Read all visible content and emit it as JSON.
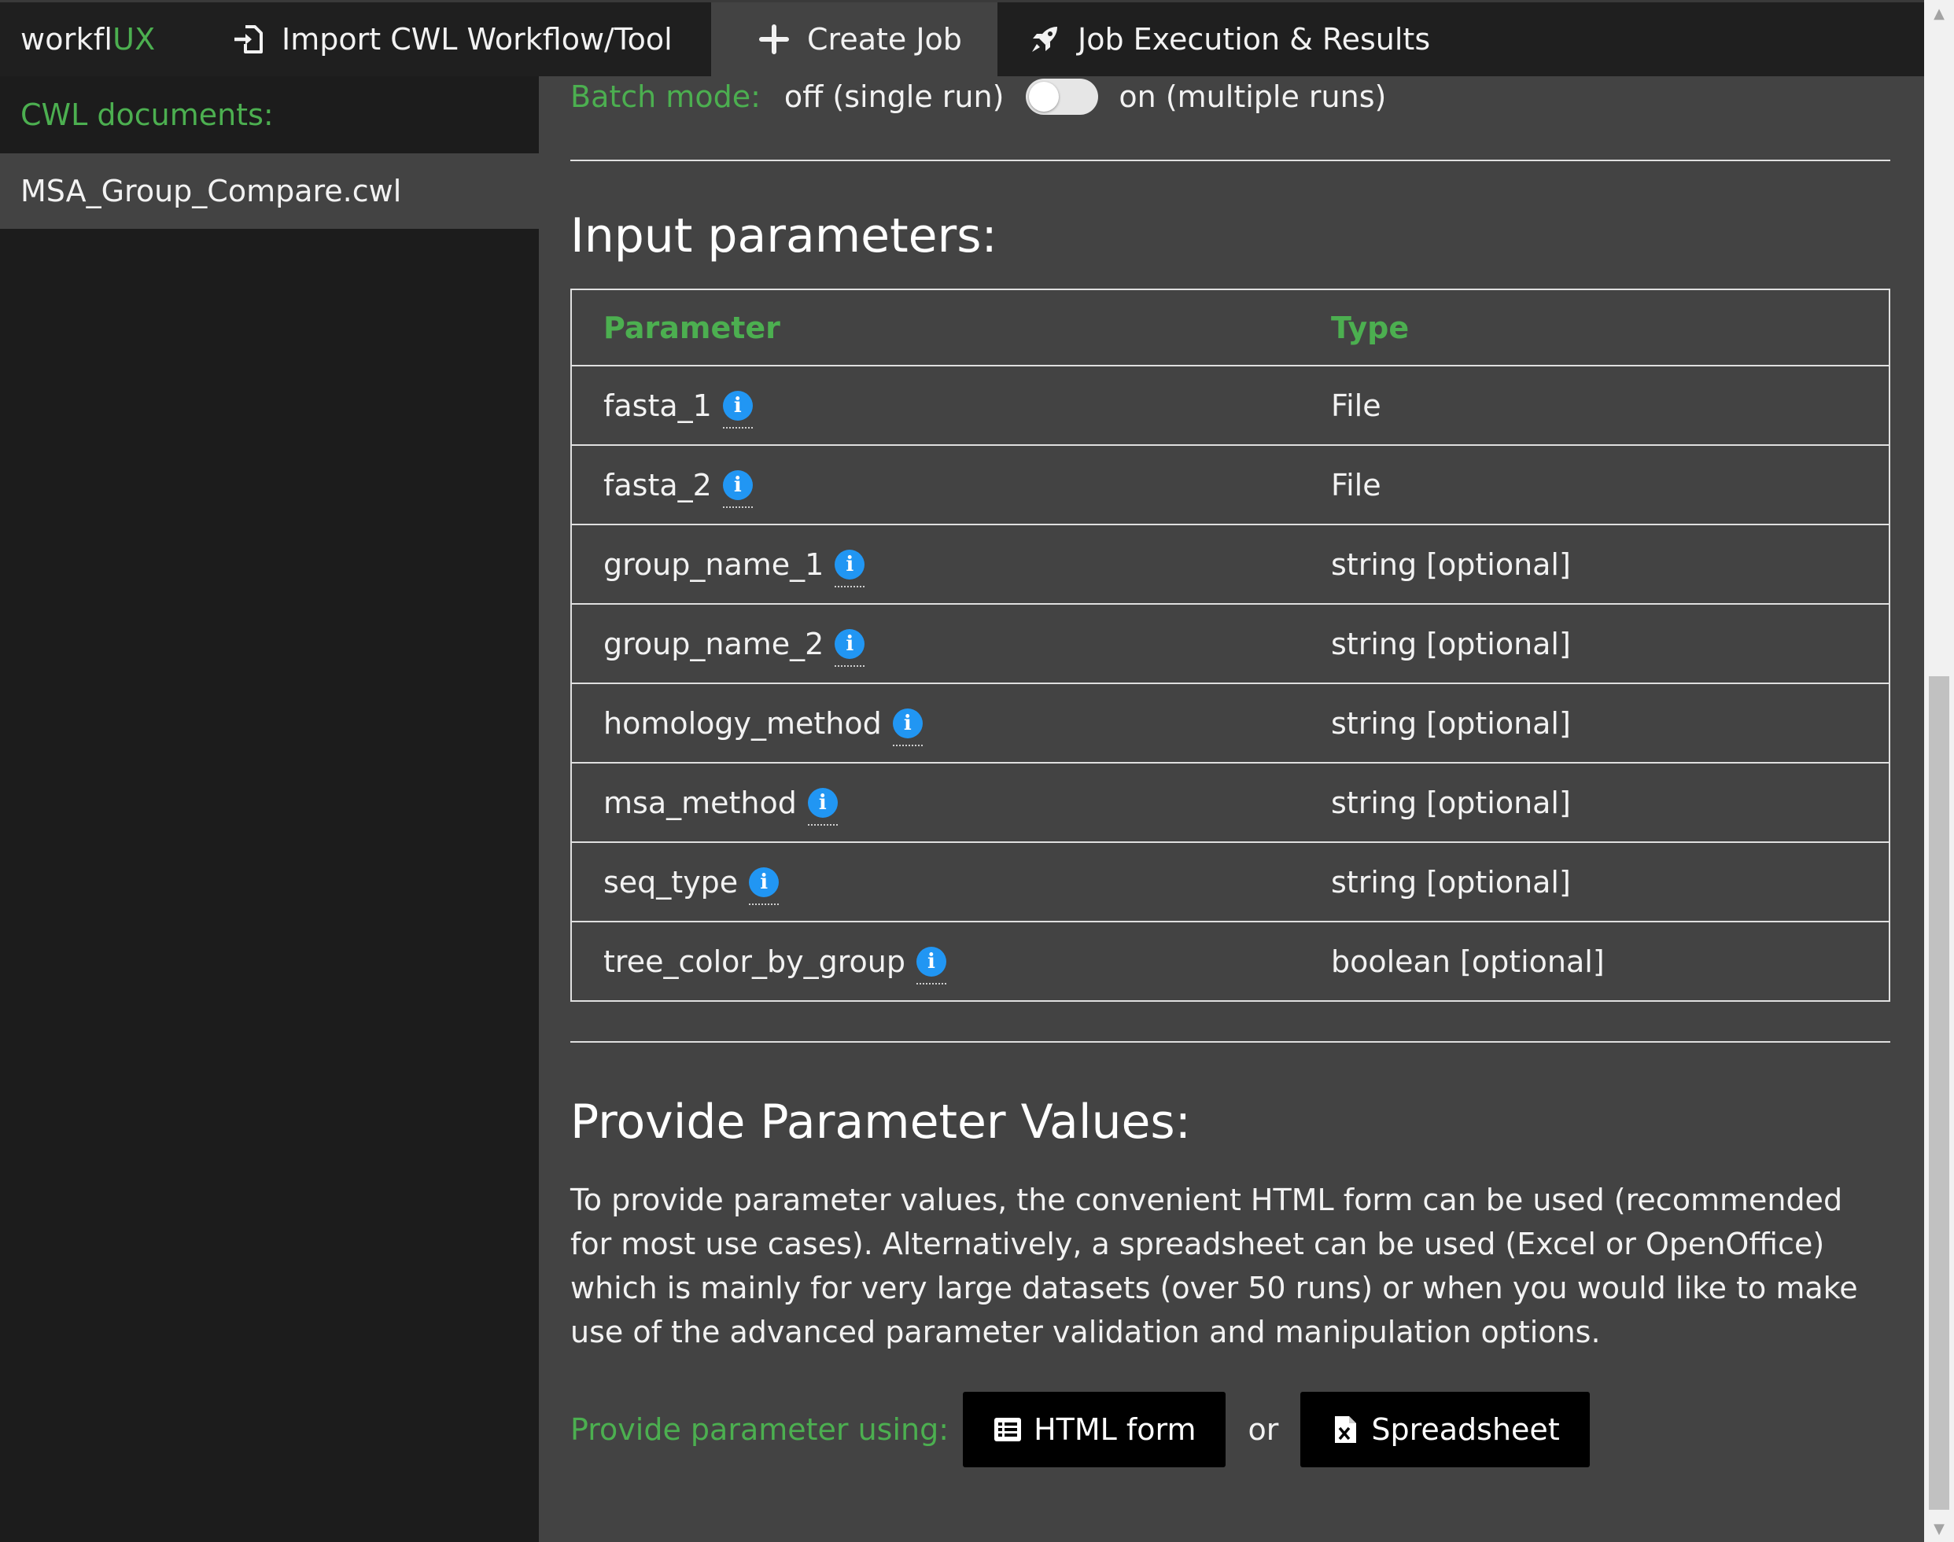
{
  "app": {
    "brand_main": "workfl",
    "brand_accent": "UX"
  },
  "nav": {
    "items": [
      {
        "label": "Import CWL Workflow/Tool",
        "icon": "import-icon"
      },
      {
        "label": "Create Job",
        "icon": "plus-icon",
        "active": true
      },
      {
        "label": "Job Execution & Results",
        "icon": "rocket-icon"
      }
    ]
  },
  "sidebar": {
    "heading": "CWL documents:",
    "documents": [
      "MSA_Group_Compare.cwl"
    ]
  },
  "batch": {
    "label": "Batch mode:",
    "off_label": "off (single run)",
    "on_label": "on (multiple runs)",
    "enabled": false
  },
  "input_params": {
    "heading": "Input parameters:",
    "columns": [
      "Parameter",
      "Type"
    ],
    "rows": [
      {
        "name": "fasta_1",
        "type": "File"
      },
      {
        "name": "fasta_2",
        "type": "File"
      },
      {
        "name": "group_name_1",
        "type": "string [optional]"
      },
      {
        "name": "group_name_2",
        "type": "string [optional]"
      },
      {
        "name": "homology_method",
        "type": "string [optional]"
      },
      {
        "name": "msa_method",
        "type": "string [optional]"
      },
      {
        "name": "seq_type",
        "type": "string [optional]"
      },
      {
        "name": "tree_color_by_group",
        "type": "boolean [optional]"
      }
    ]
  },
  "provide": {
    "heading": "Provide Parameter Values:",
    "description": "To provide parameter values, the convenient HTML form can be used (recommended for most use cases). Alternatively, a spreadsheet can be used (Excel or OpenOffice) which is mainly for very large datasets (over 50 runs) or when you would like to make use of the advanced parameter validation and manipulation options.",
    "using_label": "Provide parameter using:",
    "html_form_label": "HTML form",
    "or_label": "or",
    "spreadsheet_label": "Spreadsheet"
  },
  "colors": {
    "accent_green": "#4caf50",
    "info_blue": "#2196f3",
    "nav_bg": "#1f1f1f",
    "content_bg": "#434343"
  }
}
